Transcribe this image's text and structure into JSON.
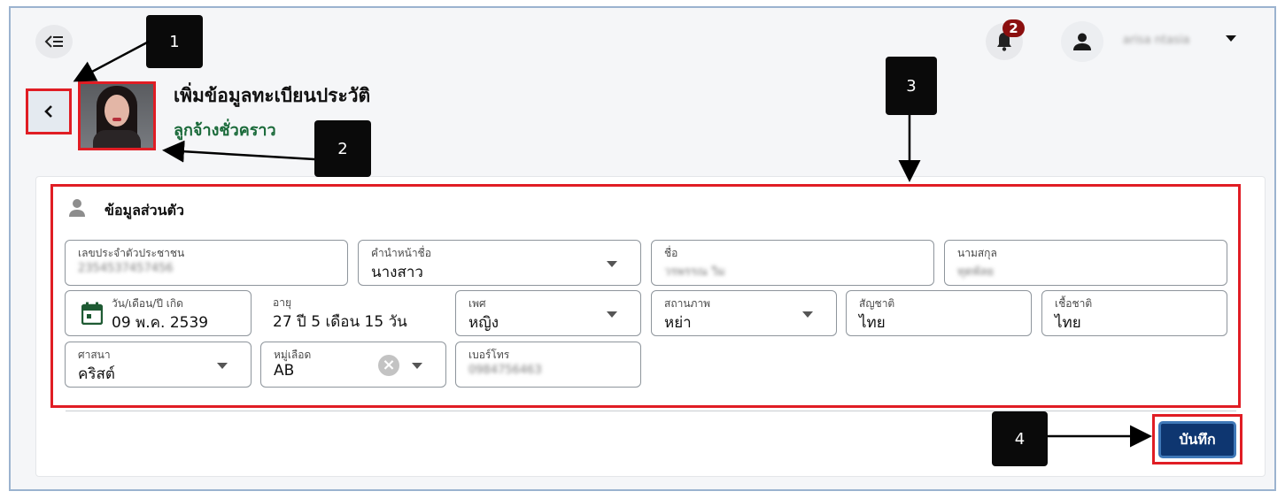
{
  "header": {
    "menu_icon": "menu-collapse-icon",
    "notification_icon": "bell-icon",
    "notification_count": "2",
    "user_icon": "account-icon",
    "user_name": "arisa ntasia"
  },
  "page": {
    "title": "เพิ่มข้อมูลทะเบียนประวัติ",
    "subtitle": "ลูกจ้างชั่วคราว",
    "back_icon": "chevron-left-icon"
  },
  "section": {
    "title": "ข้อมูลส่วนตัว",
    "icon": "person-icon"
  },
  "fields": {
    "national_id": {
      "label": "เลขประจำตัวประชาชน",
      "value": "2354537457456"
    },
    "prefix": {
      "label": "คำนำหน้าชื่อ",
      "value": "นางสาว"
    },
    "first_name": {
      "label": "ชื่อ",
      "value": "วรพรรณ วิม"
    },
    "last_name": {
      "label": "นามสกุล",
      "value": "ทุดพัลย"
    },
    "birth_date": {
      "label": "วัน/เดือน/ปี เกิด",
      "value": "09 พ.ค. 2539"
    },
    "age": {
      "label": "อายุ",
      "value": "27 ปี 5 เดือน 15 วัน"
    },
    "gender": {
      "label": "เพศ",
      "value": "หญิง"
    },
    "marital_status": {
      "label": "สถานภาพ",
      "value": "หย่า"
    },
    "nationality": {
      "label": "สัญชาติ",
      "value": "ไทย"
    },
    "ethnicity": {
      "label": "เชื้อชาติ",
      "value": "ไทย"
    },
    "religion": {
      "label": "ศาสนา",
      "value": "คริสต์"
    },
    "blood_type": {
      "label": "หมู่เลือด",
      "value": "AB"
    },
    "phone": {
      "label": "เบอร์โทร",
      "value": "0984756463"
    }
  },
  "actions": {
    "save_label": "บันทึก"
  },
  "callouts": {
    "one": "1",
    "two": "2",
    "three": "3",
    "four": "4"
  },
  "colors": {
    "highlight": "#e01d24",
    "primary_button": "#0e3670",
    "subtitle": "#1a6a3a",
    "badge": "#8b0f0f",
    "calendar_icon": "#1e5a33"
  }
}
